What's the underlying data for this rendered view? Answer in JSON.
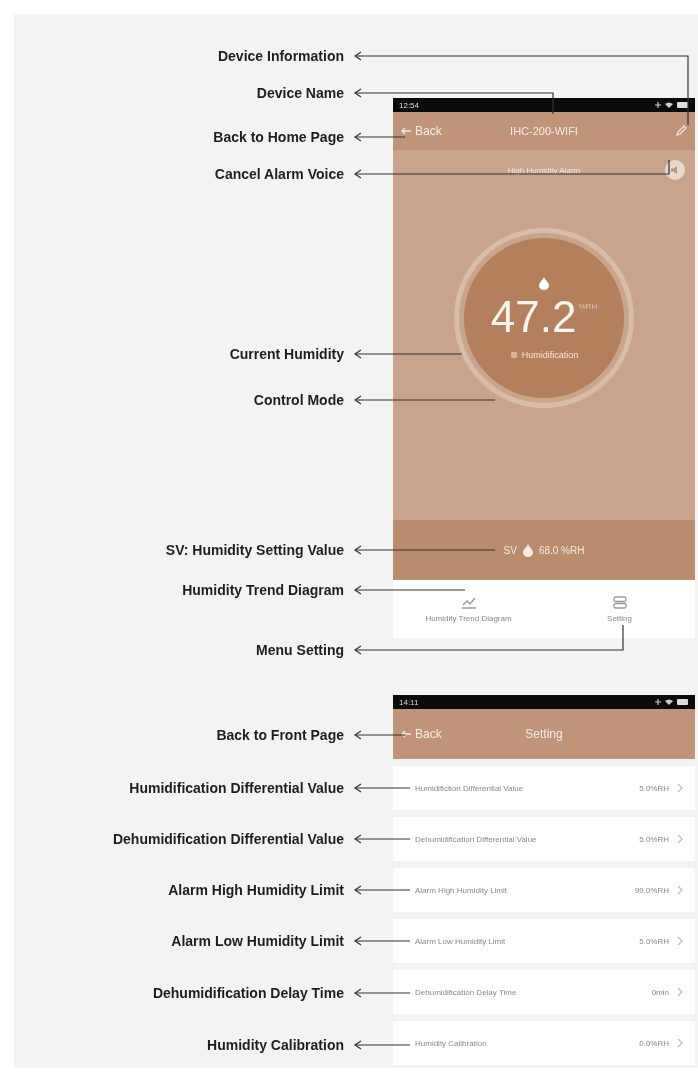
{
  "annotations": [
    {
      "label": "Device Information"
    },
    {
      "label": "Device Name"
    },
    {
      "label": "Back to Home Page"
    },
    {
      "label": "Cancel Alarm Voice"
    },
    {
      "label": "Current Humidity"
    },
    {
      "label": "Control Mode"
    },
    {
      "label": "SV: Humidity Setting Value"
    },
    {
      "label": "Humidity Trend Diagram"
    },
    {
      "label": "Menu Setting"
    },
    {
      "label": "Back to Front Page"
    },
    {
      "label": "Humidification Differential Value"
    },
    {
      "label": "Dehumidification Differential Value"
    },
    {
      "label": "Alarm High Humidity Limit"
    },
    {
      "label": "Alarm Low Humidity Limit"
    },
    {
      "label": "Dehumidification Delay Time"
    },
    {
      "label": "Humidity Calibration"
    }
  ],
  "home_screen": {
    "status_bar": {
      "time": "12:54"
    },
    "header": {
      "back": "Back",
      "title": "IHC-200-WIFI"
    },
    "alarm": "High Humidity Alarm",
    "humidity": {
      "value": "47.2",
      "unit": "%RH",
      "mode": "Humidification"
    },
    "setpoint": {
      "label": "SV",
      "value": "68.0 %RH"
    },
    "tabs": [
      {
        "label": "Humidity Trend Diagram",
        "kind": "chart"
      },
      {
        "label": "Setting",
        "kind": "menu"
      }
    ]
  },
  "settings_screen": {
    "status_bar": {
      "time": "14:11"
    },
    "header": {
      "back": "Back",
      "title": "Setting"
    },
    "rows": [
      {
        "label": "Humidifiction Differential Value",
        "value": "5.0%RH"
      },
      {
        "label": "Dehumidification Differential Value",
        "value": "5.0%RH"
      },
      {
        "label": "Alarm High Humidity Limit",
        "value": "99.0%RH"
      },
      {
        "label": "Alarm Low Humidity Limit",
        "value": "5.0%RH"
      },
      {
        "label": "Dehumidification Delay Time",
        "value": "0min"
      },
      {
        "label": "Humidity Calibration",
        "value": "0.0%RH"
      }
    ]
  }
}
